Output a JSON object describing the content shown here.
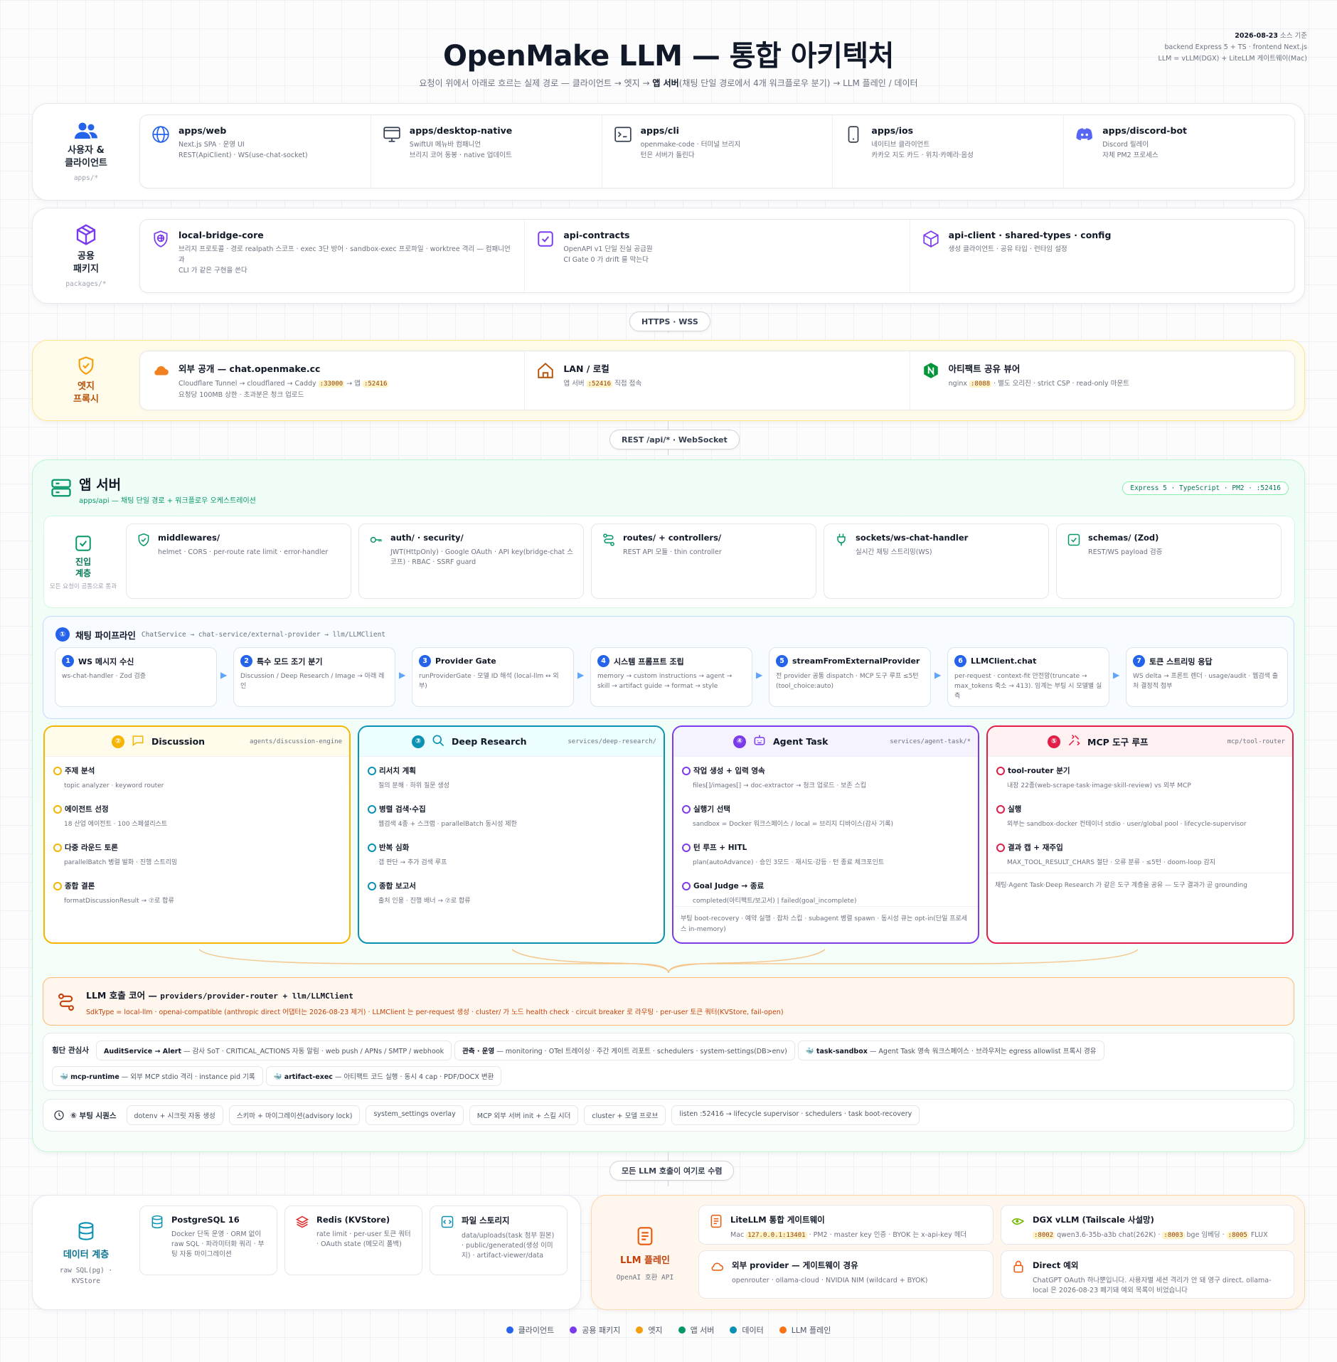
{
  "title": "OpenMake LLM — 통합 아키텍처",
  "subtitle_pre": "요청이 위에서 아래로 흐르는 실제 경로 — 클라이언트 → 엣지 → ",
  "subtitle_bold": "앱 서버",
  "subtitle_post": "(채팅 단일 경로에서 4개 워크플로우 분기) → LLM 플레인 / 데이터",
  "meta": {
    "date": "2026-08-23",
    "date_suffix": " 소스 기준",
    "line2": "backend Express 5 + TS · frontend Next.js",
    "line3": "LLM = vLLM(DGX) + LiteLLM 게이트웨이(Mac)"
  },
  "clients": {
    "title": "사용자 &\n클라이언트",
    "sub": "apps/*",
    "items": [
      {
        "name": "apps/web",
        "d1": "Next.js SPA · 운영 UI",
        "d2": "REST(ApiClient) · WS(use-chat-socket)",
        "icon": "globe-icon"
      },
      {
        "name": "apps/desktop-native",
        "d1": "SwiftUI 메뉴바 컴패니언",
        "d2": "브리지 코어 동봉 · native 업데이트",
        "icon": "desktop-icon"
      },
      {
        "name": "apps/cli",
        "d1": "openmake-code · 터미널 브리지",
        "d2": "턴은 서버가 돌린다",
        "icon": "terminal-icon"
      },
      {
        "name": "apps/ios",
        "d1": "네이티브 클라이언트",
        "d2": "카카오 지도 카드 · 위치·카메라·음성",
        "icon": "phone-icon"
      },
      {
        "name": "apps/discord-bot",
        "d1": "Discord 릴레이",
        "d2": "자체 PM2 프로세스",
        "icon": "discord-icon"
      }
    ]
  },
  "packages": {
    "title": "공용\n패키지",
    "sub": "packages/*",
    "items": [
      {
        "name": "local-bridge-core",
        "d1": "브리지 프로토콜 · 경로 realpath 스코프 · exec 3단 방어 · sandbox-exec 프로파일 · worktree 격리 — 컴패니언과",
        "d2": "CLI 가 같은 구현을 쓴다",
        "icon": "shield-globe-icon"
      },
      {
        "name": "api-contracts",
        "d1": "OpenAPI v1 단일 진실 공급원",
        "d2": "CI Gate 0 가 drift 를 막는다",
        "icon": "check-square-icon"
      },
      {
        "name": "api-client · shared-types · config",
        "d1": "생성 클라이언트 · 공유 타입 · 런타임 설정",
        "d2": "",
        "icon": "package-icon"
      }
    ]
  },
  "conn1": "HTTPS · WSS",
  "edge": {
    "title": "엣지\n프록시",
    "items": [
      {
        "name": "외부 공개 — chat.openmake.cc",
        "d1a": "Cloudflare Tunnel → cloudflared → Caddy ",
        "c1": ":33000",
        "d1b": " → 앱 ",
        "c2": ":52416",
        "d2": "요청당 100MB 상한 · 초과분은 청크 업로드",
        "icon": "cloud-icon"
      },
      {
        "name": "LAN / 로컬",
        "d1a": "앱 서버 ",
        "c1": ":52416",
        "d1b": " 직접 접속",
        "icon": "home-icon"
      },
      {
        "name": "아티팩트 공유 뷰어",
        "d1a": "nginx ",
        "c1": ":8088",
        "d1b": " · 별도 오리진 · strict CSP · read-only 마운트",
        "icon": "nginx-icon"
      }
    ]
  },
  "conn2": "REST /api/* · WebSocket",
  "app": {
    "title": "앱 서버",
    "sub": "apps/api — 채팅 단일 경로 + 워크플로우 오케스트레이션",
    "badge": "Express 5 · TypeScript · PM2 · :52416",
    "entry": {
      "title": "진입\n계층",
      "sub": "모든 요청이 공통으로 통과",
      "items": [
        {
          "name": "middlewares/",
          "d": "helmet · CORS · per-route rate limit · error-handler",
          "icon": "shield-check-icon"
        },
        {
          "name": "auth/ · security/",
          "d": "JWT(HttpOnly) · Google OAuth · API key(bridge-chat 스코프) · RBAC · SSRF guard",
          "icon": "key-icon"
        },
        {
          "name": "routes/ + controllers/",
          "d": "REST API 모듈 · thin controller",
          "icon": "route-icon"
        },
        {
          "name": "sockets/ws-chat-handler",
          "d": "실시간 채팅 스트리밍(WS)",
          "icon": "plug-icon"
        },
        {
          "name": "schemas/ (Zod)",
          "d": "REST/WS payload 검증",
          "icon": "check-square-icon"
        }
      ]
    },
    "pipeline": {
      "num": "①",
      "title": "채팅 파이프라인",
      "path": "ChatService → chat-service/external-provider → llm/LLMClient",
      "steps": [
        {
          "n": "1",
          "name": "WS 메시지 수신",
          "d": "ws-chat-handler · Zod 검증"
        },
        {
          "n": "2",
          "name": "특수 모드 조기 분기",
          "d": "Discussion / Deep Research / Image → 아래 레인"
        },
        {
          "n": "3",
          "name": "Provider Gate",
          "d": "runProviderGate · 모델 ID 해석 (local-llm ↔ 외부)"
        },
        {
          "n": "4",
          "name": "시스템 프롬프트 조립",
          "d": "memory → custom instructions → agent → skill → artifact guide → format → style"
        },
        {
          "n": "5",
          "name": "streamFromExternalProvider",
          "d": "전 provider 공통 dispatch · MCP 도구 루프 ≤5턴 (tool_choice:auto)"
        },
        {
          "n": "6",
          "name": "LLMClient.chat",
          "d": "per-request · context-fit 안전망(truncate → max_tokens 축소 → 413). 임계는 부팅 시 모델별 실측"
        },
        {
          "n": "7",
          "name": "토큰 스트리밍 응답",
          "d": "WS delta → 프론트 렌더 · usage/audit · 웹검색 출처 결정적 첨부"
        }
      ]
    },
    "workflows": [
      {
        "num": "②",
        "name": "Discussion",
        "path": "agents/discussion-engine",
        "icon": "chat-icon",
        "color": "#f5b400",
        "items": [
          {
            "t": "주제 분석",
            "d": "topic analyzer · keyword router"
          },
          {
            "t": "에이전트 선정",
            "d": "18 산업 에이전트 · 100 스페셜리스트"
          },
          {
            "t": "다중 라운드 토론",
            "d": "parallelBatch 병렬 발화 · 진행 스트리밍"
          },
          {
            "t": "종합 결론",
            "d": "formatDiscussionResult → ⑦로 합류"
          }
        ],
        "foot": ""
      },
      {
        "num": "③",
        "name": "Deep Research",
        "path": "services/deep-research/",
        "icon": "search-icon",
        "color": "#0891b2",
        "items": [
          {
            "t": "리서치 계획",
            "d": "질의 분해 · 하위 질문 생성"
          },
          {
            "t": "병렬 검색·수집",
            "d": "웹검색 4종 + 스크랩 · parallelBatch 동시성 제한"
          },
          {
            "t": "반복 심화",
            "d": "갭 판단 → 추가 검색 루프"
          },
          {
            "t": "종합 보고서",
            "d": "출처 인용 · 진행 배너 → ⑦로 합류"
          }
        ],
        "foot": ""
      },
      {
        "num": "④",
        "name": "Agent Task",
        "path": "services/agent-task/*",
        "icon": "robot-icon",
        "color": "#7c3aed",
        "items": [
          {
            "t": "작업 생성 + 입력 영속",
            "d": "files[]/images[] → doc-extractor → 청크 업로드 · 보존 스킵"
          },
          {
            "t": "실행기 선택",
            "d": "sandbox = Docker 워크스페이스 / local = 브리지 디바이스(감사 기록)"
          },
          {
            "t": "턴 루프 + HITL",
            "d": "plan(autoAdvance) · 승인 3모드 · 재시도·강등 · 턴 종료 체크포인트"
          },
          {
            "t": "Goal Judge → 종료",
            "d": "completed(아티팩트/보고서) | failed(goal_incomplete)"
          }
        ],
        "foot": "부팅 boot-recovery · 예약 실행 · 잡차 스킵 · subagent 병렬 spawn · 동시성 큐는 opt-in(단일 프로세스 in-memory)"
      },
      {
        "num": "⑤",
        "name": "MCP 도구 루프",
        "path": "mcp/tool-router",
        "icon": "tools-icon",
        "color": "#e11d48",
        "items": [
          {
            "t": "tool-router 분기",
            "d": "내장 22종(web-scrape·task·image·skill-review) vs 외부 MCP"
          },
          {
            "t": "실행",
            "d": "외부는 sandbox-docker 컨테이너 stdio · user/global pool · lifecycle-supervisor"
          },
          {
            "t": "결과 캡 + 재주입",
            "d": "MAX_TOOL_RESULT_CHARS 절단 · 오류 분류 · ≤5턴 · doom-loop 감지"
          }
        ],
        "foot": "채팅·Agent Task·Deep Research 가 같은 도구 계층을 공유 — 도구 결과가 곧 grounding"
      }
    ],
    "core": {
      "title": "LLM 호출 코어 —",
      "path": "providers/provider-router + llm/LLMClient",
      "d": "SdkType = local-llm · openai-compatible (anthropic direct 어댑터는 2026-08-23 제거) · LLMClient 는 per-request 생성 · cluster/ 가 노드 health check · circuit breaker 로 라우팅 · per-user 토큰 쿼터(KVStore, fail-open)"
    },
    "cross": {
      "label": "횡단 관심사",
      "chips": [
        {
          "b": "AuditService → Alert",
          "r": " — 감사 SoT · CRITICAL_ACTIONS 자동 알림 · web push / APNs / SMTP / webhook"
        },
        {
          "b": "관측 · 운영",
          "r": " — monitoring · OTel 트레이싱 · 주간 게이트 리포트 · schedulers · system-settings(DB>env)"
        },
        {
          "b": "🐳 task-sandbox",
          "r": " — Agent Task 영속 워크스페이스 · 브라우저는 egress allowlist 프록시 경유"
        },
        {
          "b": "🐳 mcp-runtime",
          "r": " — 외부 MCP stdio 격리 · instance pid 기록"
        },
        {
          "b": "🐳 artifact-exec",
          "r": " — 아티팩트 코드 실행 · 동시 4 cap · PDF/DOCX 변환"
        }
      ]
    },
    "boot": {
      "label": "⑥ 부팅 시퀀스",
      "steps": [
        "dotenv + 시크릿 자동 생성",
        "스키마 + 마이그레이션(advisory lock)",
        "system_settings overlay",
        "MCP 외부 서버 init + 스킬 시더",
        "cluster + 모델 프로브",
        "listen :52416 → lifecycle supervisor · schedulers · task boot-recovery"
      ]
    }
  },
  "conn3": "모든 LLM 호출이 여기로 수렴",
  "data": {
    "title": "데이터 계층",
    "sub": "raw SQL(pg) ·\nKVStore",
    "items": [
      {
        "name": "PostgreSQL 16",
        "d": "Docker 단독 운영 · ORM 없이 raw SQL · 파라미터화 쿼리 · 부팅 자동 마이그레이션",
        "icon": "database-icon"
      },
      {
        "name": "Redis (KVStore)",
        "d": "rate limit · per-user 토큰 쿼터 · OAuth state (메모리 폴백)",
        "icon": "layers-icon"
      },
      {
        "name": "파일 스토리지",
        "d": "data/uploads(task 첨부 원본) · public/generated(생성 이미지) · artifact-viewer/data",
        "icon": "file-code-icon"
      }
    ]
  },
  "llm": {
    "title": "LLM 플레인",
    "sub": "OpenAI 호환 API",
    "items": [
      {
        "name": "LiteLLM 통합 게이트웨이",
        "d1": "Mac ",
        "c1": "127.0.0.1:13401",
        "d2": " · PM2 · master key 인증 · BYOK 는 x-api-key 헤더",
        "icon": "doc-icon"
      },
      {
        "name": "DGX vLLM (Tailscale 사설망)",
        "c1": ":8002",
        "d1": " qwen3.6-35b-a3b chat(262K) · ",
        "c2": ":8003",
        "d2": " bge 임베딩 · ",
        "c3": ":8005",
        "d3": " FLUX",
        "icon": "nvidia-icon"
      },
      {
        "name": "외부 provider — 게이트웨이 경유",
        "d": "openrouter · ollama-cloud · NVIDIA NIM (wildcard + BYOK)",
        "icon": "cloud-icon"
      },
      {
        "name": "Direct 예외",
        "d": "ChatGPT OAuth 하나뿐입니다. 사용자별 세션 격리가 안 돼 영구 direct. ollama-local 은 2026-08-23 폐기돼 예외 목록이 비었습니다",
        "icon": "lock-icon"
      }
    ]
  },
  "legend": [
    {
      "label": "클라이언트",
      "color": "#2563eb"
    },
    {
      "label": "공용 패키지",
      "color": "#7c3aed"
    },
    {
      "label": "엣지",
      "color": "#f59e0b"
    },
    {
      "label": "앱 서버",
      "color": "#059669"
    },
    {
      "label": "데이터",
      "color": "#0891b2"
    },
    {
      "label": "LLM 플레인",
      "color": "#f97316"
    }
  ]
}
